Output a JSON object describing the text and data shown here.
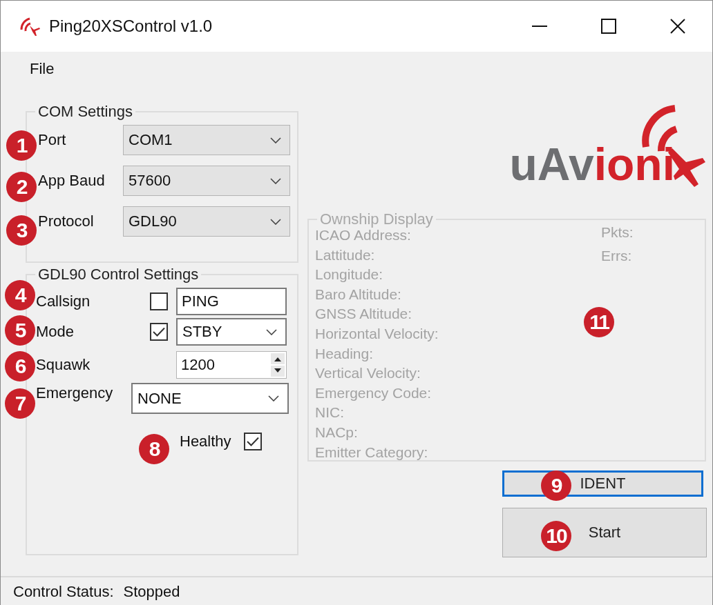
{
  "window": {
    "title": "Ping20XSControl v1.0"
  },
  "menu": [
    {
      "label": "File"
    }
  ],
  "com_settings": {
    "title": "COM Settings",
    "fields": [
      {
        "label": "Port",
        "value": "COM1"
      },
      {
        "label": "App Baud",
        "value": "57600"
      },
      {
        "label": "Protocol",
        "value": "GDL90"
      }
    ]
  },
  "gdl90_settings": {
    "title": "GDL90 Control Settings",
    "callsign": {
      "label": "Callsign",
      "checked": false,
      "value": "PING"
    },
    "mode": {
      "label": "Mode",
      "checked": true,
      "value": "STBY"
    },
    "squawk": {
      "label": "Squawk",
      "value": "1200"
    },
    "emergency": {
      "label": "Emergency",
      "value": "NONE"
    },
    "healthy": {
      "label": "Healthy",
      "checked": true
    }
  },
  "logo": {
    "text_dark": "uAv",
    "text_red": "ioni"
  },
  "ownship_display": {
    "title": "Ownship Display",
    "fields": [
      "ICAO Address:",
      "Lattitude:",
      "Longitude:",
      "Baro Altitude:",
      "GNSS Altitude:",
      "Horizontal Velocity:",
      "Heading:",
      "Vertical Velocity:",
      "Emergency Code:",
      "NIC:",
      "NACp:",
      "Emitter Category:"
    ],
    "counters": [
      "Pkts:",
      "Errs:"
    ]
  },
  "buttons": [
    {
      "label": "IDENT",
      "focused": true
    },
    {
      "label": "Start",
      "focused": false
    }
  ],
  "callouts": [
    "1",
    "2",
    "3",
    "4",
    "5",
    "6",
    "7",
    "8",
    "9",
    "10",
    "11"
  ],
  "status_bar": {
    "label": "Control Status:",
    "value": "Stopped"
  }
}
